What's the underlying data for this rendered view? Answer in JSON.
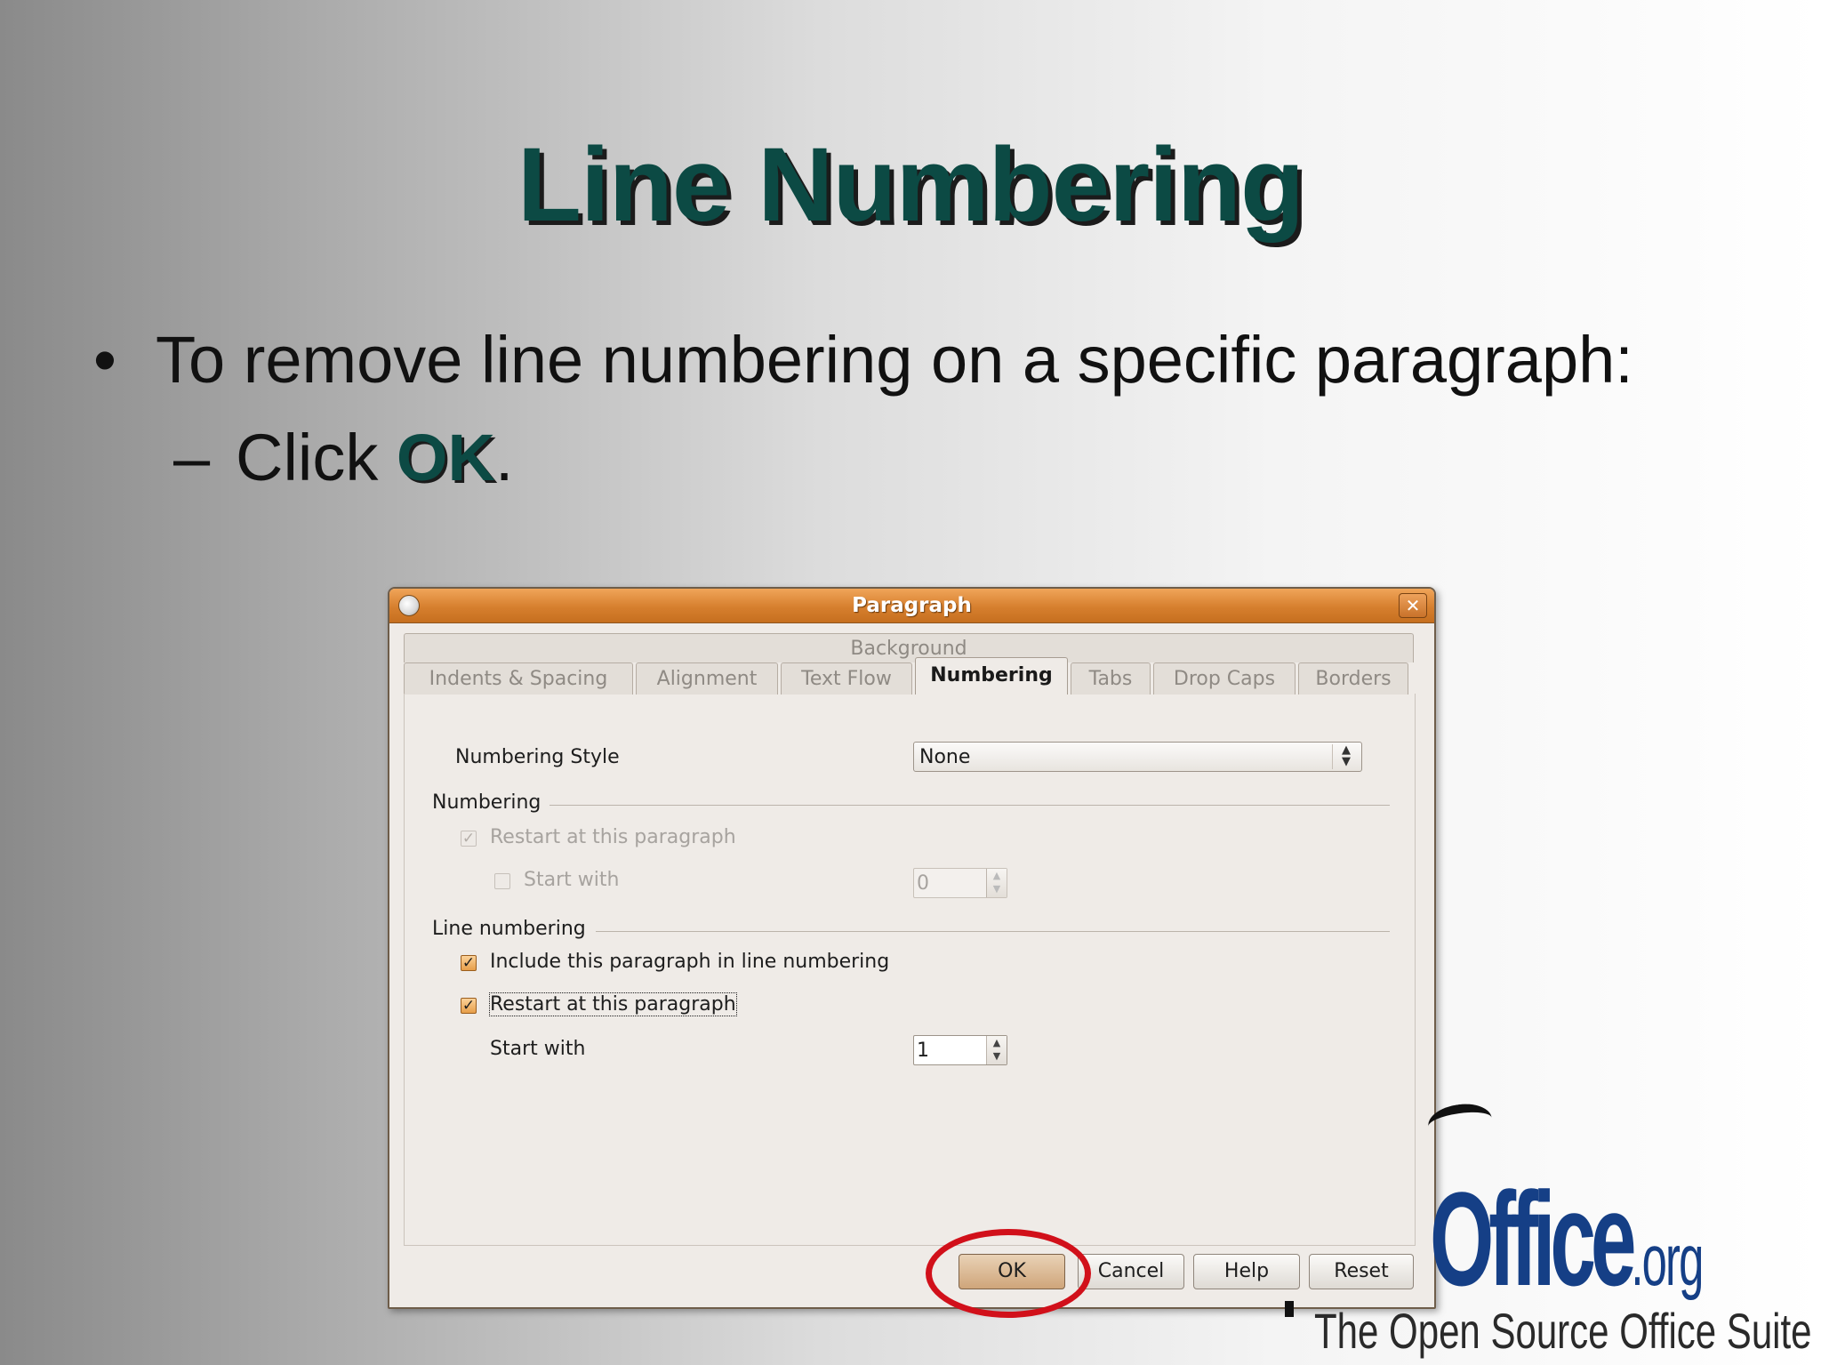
{
  "slide": {
    "title": "Line Numbering",
    "bullet_mark": "•",
    "bullet_text": "To remove line numbering on a specific paragraph:",
    "sub_mark": "–",
    "sub_text_prefix": "Click ",
    "sub_text_ok": "OK",
    "sub_text_suffix": "."
  },
  "dialog": {
    "title": "Paragraph",
    "close_glyph": "✕",
    "back_tab": "Background",
    "tabs": [
      "Indents & Spacing",
      "Alignment",
      "Text Flow",
      "Numbering",
      "Tabs",
      "Drop Caps",
      "Borders"
    ],
    "active_tab": "Numbering",
    "numbering_style_label": "Numbering Style",
    "numbering_style_value": "None",
    "numbering_section": "Numbering",
    "restart_label_disabled": "Restart at this paragraph",
    "start_with_label_disabled": "Start with",
    "start_with_value_disabled": "0",
    "line_numbering_section": "Line numbering",
    "include_label": "Include this paragraph in line numbering",
    "include_checked": true,
    "restart_label": "Restart at this paragraph",
    "restart_checked": true,
    "start_with_label": "Start with",
    "start_with_value": "1",
    "buttons": {
      "ok": "OK",
      "cancel": "Cancel",
      "help": "Help",
      "reset": "Reset"
    }
  },
  "logo": {
    "main": "Office",
    "suffix": ".org",
    "tagline": "The Open Source Office Suite"
  },
  "colors": {
    "title": "#0c4a44",
    "titlebar": "#d67f2e",
    "highlight_ring": "#d1101a",
    "logo": "#153f86"
  }
}
